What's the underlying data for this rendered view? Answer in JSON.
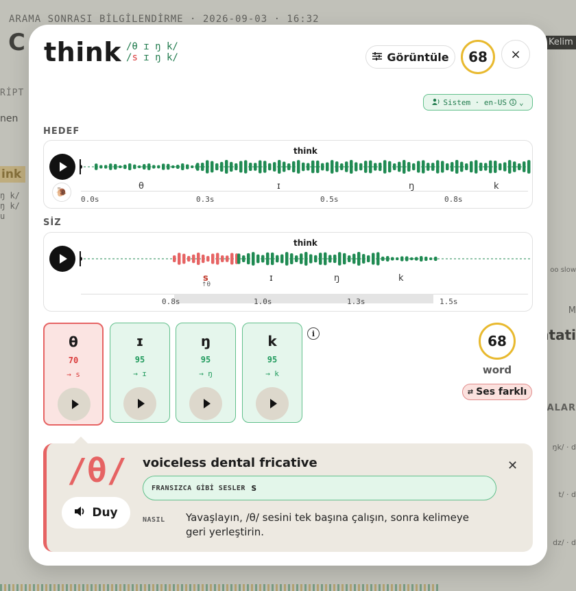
{
  "background": {
    "top_bar": "ARAMA SONRASI BİLGİLENDİRME · 2026-09-03 · 16:32",
    "big_title_fragment": "C",
    "side_label": "RİPT",
    "side_text": "nen",
    "think_tag": "ink",
    "ipa_lines": [
      "ŋ k/",
      "ŋ k/",
      "u"
    ],
    "right_label": "Kelim",
    "right_texts": [
      "oo slow",
      "M",
      "ntati",
      "ALAR",
      "ŋk/ · d",
      "t/ · d",
      "dz/ · d"
    ]
  },
  "modal": {
    "word": "think",
    "ipa_target": "/θ ɪ ŋ k/",
    "ipa_user_bad": "s",
    "ipa_user_rest": " ɪ ŋ k/",
    "ipa_user_prefix": "/",
    "view_button": "Görüntüle",
    "score": "68",
    "close_icon": "×",
    "system_pill": "Sistem · en-US",
    "target_label": "HEDEF",
    "user_label": "SİZ",
    "target_wave": {
      "word": "think",
      "phonemes": [
        "θ",
        "ɪ",
        "ŋ",
        "k"
      ],
      "times": [
        "0.0s",
        "0.3s",
        "0.5s",
        "0.8s"
      ]
    },
    "user_wave": {
      "word": "think",
      "phonemes": [
        "s",
        "ɪ",
        "ŋ",
        "k"
      ],
      "sub_note": "↑θ",
      "times": [
        "0.8s",
        "1.0s",
        "1.3s",
        "1.5s"
      ]
    },
    "phoneme_cards": [
      {
        "symbol": "θ",
        "score": "70",
        "heard": "→ s",
        "status": "bad"
      },
      {
        "symbol": "ɪ",
        "score": "95",
        "heard": "→ ɪ",
        "status": "good"
      },
      {
        "symbol": "ŋ",
        "score": "95",
        "heard": "→ ŋ",
        "status": "good"
      },
      {
        "symbol": "k",
        "score": "95",
        "heard": "→ k",
        "status": "good"
      }
    ],
    "word_score": "68",
    "word_score_label": "word",
    "diff_pill": "Ses farklı",
    "detail": {
      "symbol": "/θ/",
      "listen_button": "Duy",
      "title": "voiceless dental fricative",
      "similar_label": "FRANSIZCA GİBİ SESLER",
      "similar_value": "s",
      "how_label": "NASIL",
      "how_text": "Yavaşlayın, /θ/ sesini tek başına çalışın, sonra kelimeye geri yerleştirin."
    }
  },
  "colors": {
    "good": "#1f8a52",
    "bad": "#e66363",
    "score_ring": "#e8b92e"
  }
}
